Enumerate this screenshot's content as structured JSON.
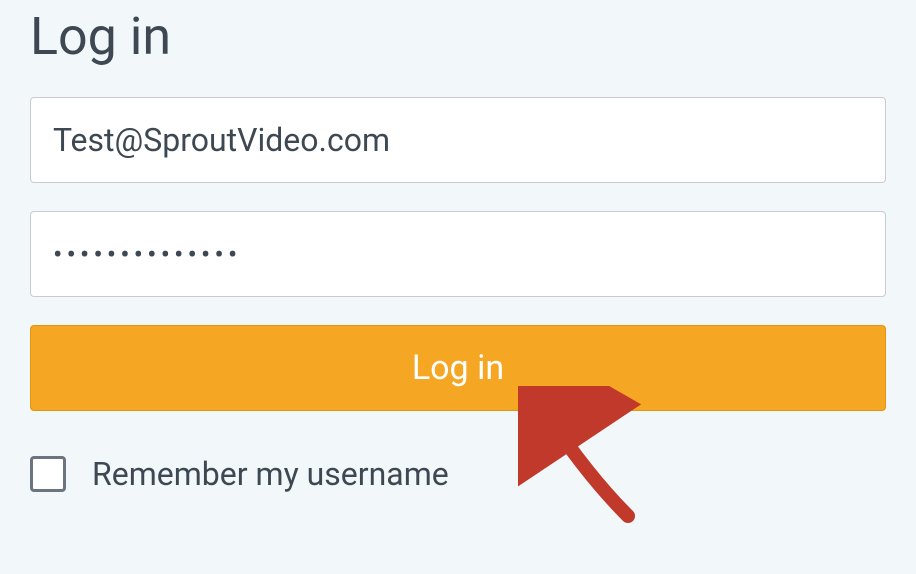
{
  "title": "Log in",
  "form": {
    "email_value": "Test@SproutVideo.com",
    "password_value": "••••••••••••••",
    "submit_label": "Log in",
    "remember_label": "Remember my username"
  },
  "colors": {
    "background": "#f2f7fa",
    "text": "#3d4852",
    "button": "#f5a623",
    "button_text": "#ffffff",
    "border": "#c8ccd0",
    "arrow": "#c0392b"
  }
}
